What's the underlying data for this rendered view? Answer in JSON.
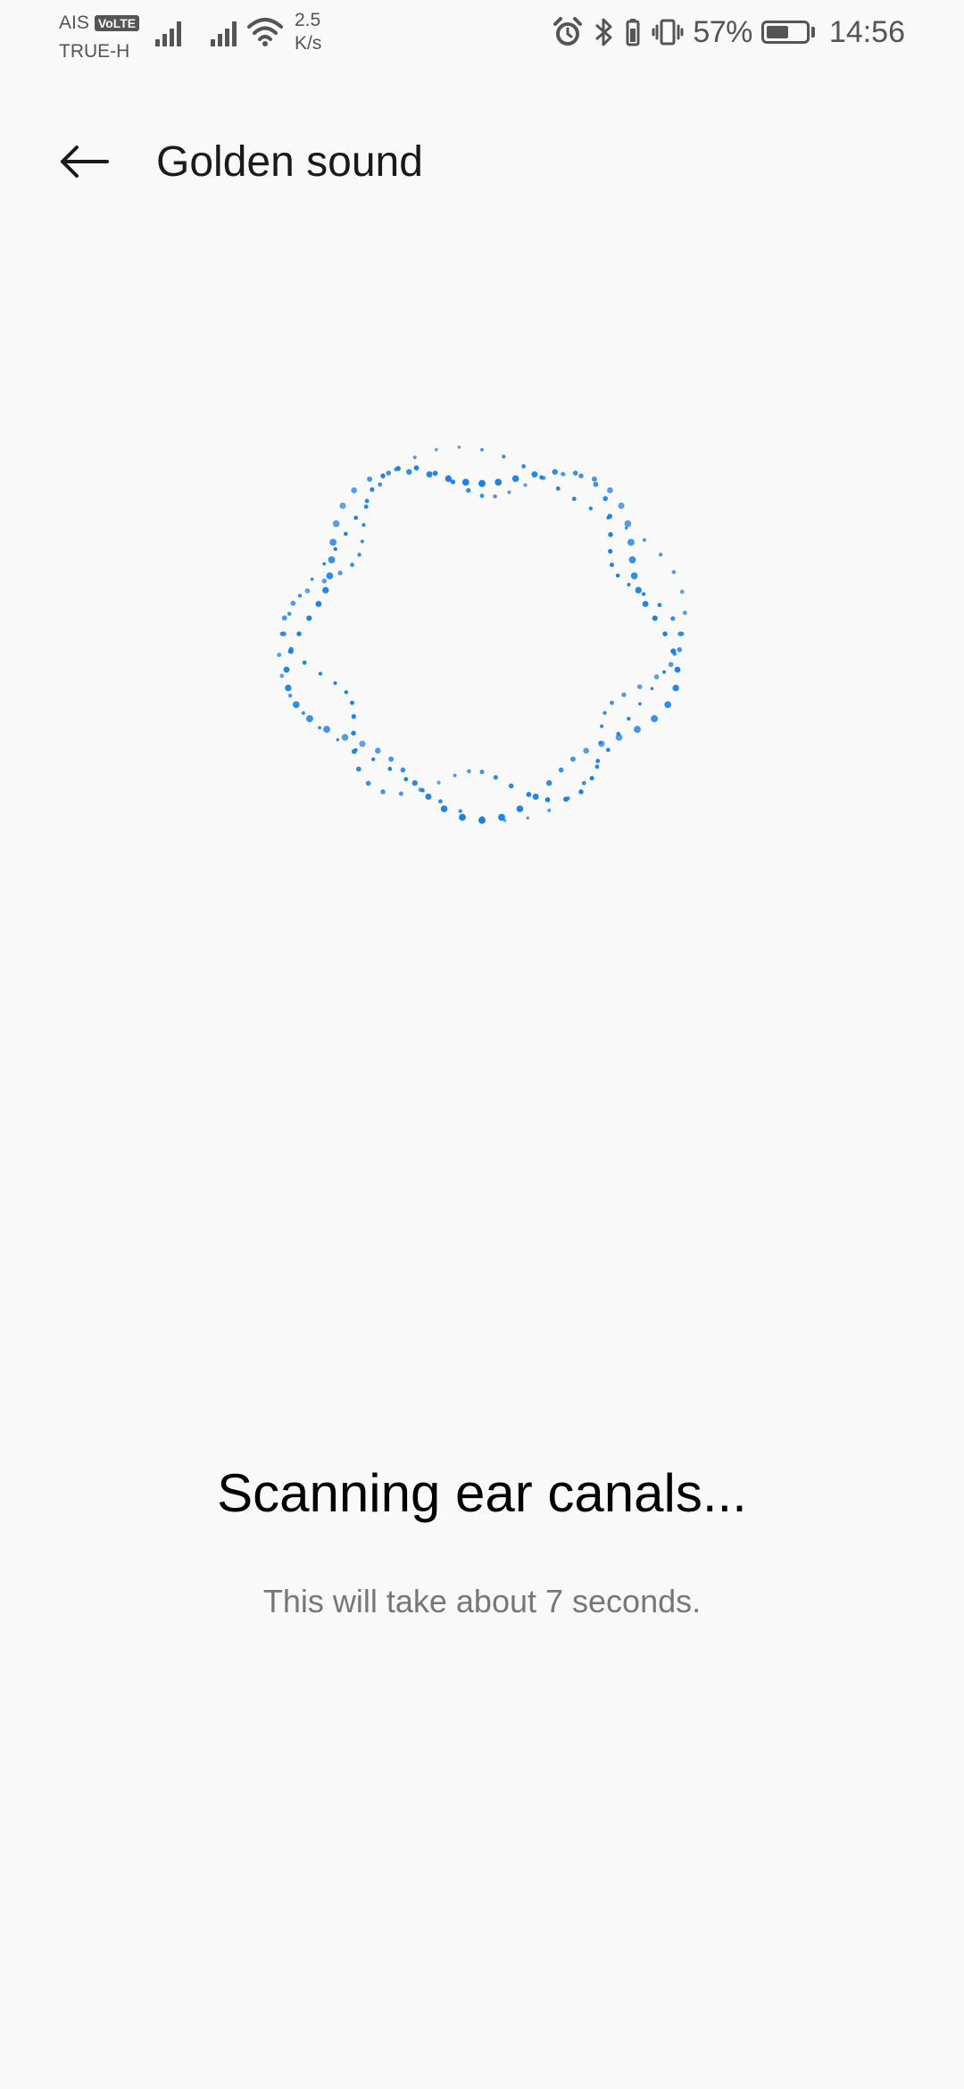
{
  "status_bar": {
    "carrier_1": "AIS",
    "volte_badge": "VoLTE",
    "carrier_2": "TRUE-H",
    "speed_value": "2.5",
    "speed_unit": "K/s",
    "battery_percent": "57%",
    "battery_level": 0.57,
    "time": "14:56",
    "icons": [
      "signal-icon",
      "signal-icon",
      "wifi-icon",
      "alarm-icon",
      "bluetooth-icon",
      "vibrate-icon",
      "battery-icon"
    ]
  },
  "header": {
    "back_icon": "arrow-left-icon",
    "title": "Golden sound"
  },
  "main": {
    "status_title": "Scanning ear canals...",
    "status_subtitle": "This will take about 7 seconds."
  },
  "colors": {
    "accent": "#1a7fe6",
    "background": "#f9f9f9",
    "text_primary": "#000000",
    "text_secondary": "#777777"
  }
}
